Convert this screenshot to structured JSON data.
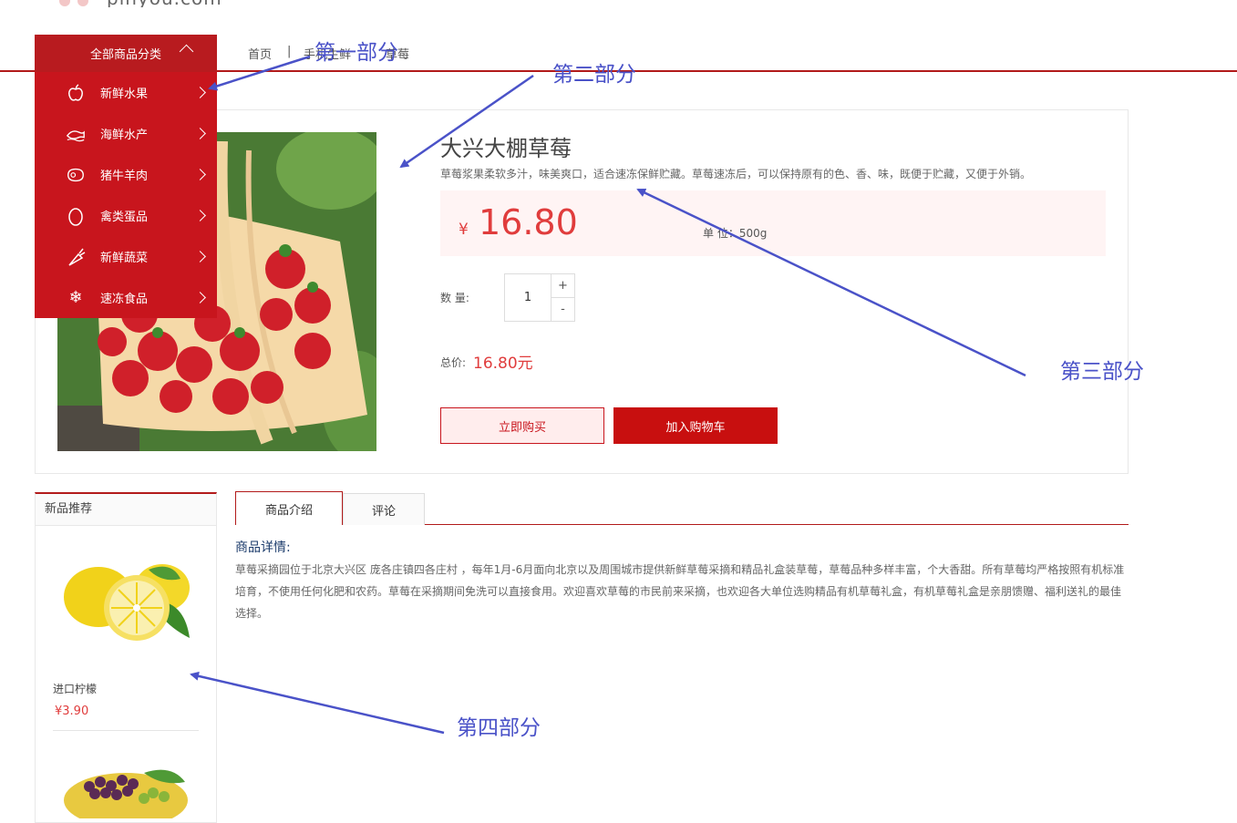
{
  "site": {
    "logo_text": "pinyou.com"
  },
  "breadcrumb": {
    "home": "首页",
    "sep": "|",
    "item2": "手机生鲜",
    "item3": "草莓"
  },
  "category_menu": {
    "title": "全部商品分类",
    "items": [
      {
        "label": "新鲜水果",
        "icon": "apple-icon"
      },
      {
        "label": "海鲜水产",
        "icon": "fish-icon"
      },
      {
        "label": "猪牛羊肉",
        "icon": "meat-icon"
      },
      {
        "label": "禽类蛋品",
        "icon": "egg-icon"
      },
      {
        "label": "新鲜蔬菜",
        "icon": "carrot-icon"
      },
      {
        "label": "速冻食品",
        "icon": "snowflake-icon"
      }
    ]
  },
  "product": {
    "title": "大兴大棚草莓",
    "description": "草莓浆果柔软多汁，味美爽口，适合速冻保鲜贮藏。草莓速冻后，可以保持原有的色、香、味，既便于贮藏，又便于外销。",
    "currency": "¥",
    "price": "16.80",
    "unit": "单 位：500g",
    "quantity_label": "数 量:",
    "quantity": "1",
    "plus": "+",
    "minus": "-",
    "total_label": "总价:",
    "total_value": "16.80元",
    "buy_now": "立即购买",
    "add_cart": "加入购物车"
  },
  "new_products": {
    "title": "新品推荐",
    "items": [
      {
        "name": "进口柠檬",
        "price": "¥3.90"
      }
    ]
  },
  "tabs": {
    "intro": "商品介绍",
    "comments": "评论"
  },
  "detail": {
    "heading": "商品详情:",
    "body": "草莓采摘园位于北京大兴区 庞各庄镇四各庄村 ，每年1月-6月面向北京以及周围城市提供新鲜草莓采摘和精品礼盒装草莓，草莓品种多样丰富，个大香甜。所有草莓均严格按照有机标准培育，不使用任何化肥和农药。草莓在采摘期间免洗可以直接食用。欢迎喜欢草莓的市民前来采摘，也欢迎各大单位选购精品有机草莓礼盒，有机草莓礼盒是亲朋馈赠、福利送礼的最佳选择。"
  },
  "annotations": {
    "part1": "第一部分",
    "part2": "第二部分",
    "part3": "第三部分",
    "part4": "第四部分"
  },
  "colors": {
    "brand_red": "#c8151d",
    "price_red": "#e03c3c",
    "annotation_blue": "#4a52c8"
  }
}
